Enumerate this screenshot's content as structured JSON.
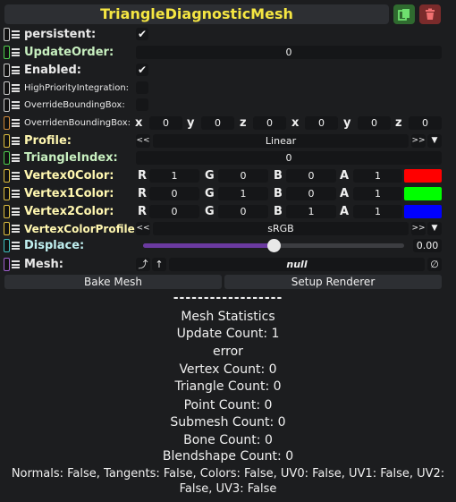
{
  "header": {
    "title": "TriangleDiagnosticMesh",
    "copy_icon": "copy-icon",
    "delete_icon": "trash-icon"
  },
  "fields": {
    "persistent": {
      "label": "persistent:",
      "checked": true
    },
    "update_order": {
      "label": "UpdateOrder:",
      "value": "0"
    },
    "enabled": {
      "label": "Enabled:",
      "checked": true
    },
    "high_priority": {
      "label": "HighPriorityIntegration:",
      "checked": false
    },
    "override_bbox": {
      "label": "OverrideBoundingBox:",
      "checked": false
    },
    "overriden_bbox": {
      "label": "OverridenBoundingBox:",
      "axes": [
        "x",
        "y",
        "z",
        "x",
        "y",
        "z"
      ],
      "values": [
        "0",
        "0",
        "0",
        "0",
        "0",
        "0"
      ]
    },
    "profile": {
      "label": "Profile:",
      "value": "Linear",
      "prev": "<<",
      "next": ">>"
    },
    "triangle_index": {
      "label": "TriangleIndex:",
      "value": "0"
    },
    "vertex0": {
      "label": "Vertex0Color:",
      "r": "1",
      "g": "0",
      "b": "0",
      "a": "1",
      "swatch": "#ff0000"
    },
    "vertex1": {
      "label": "Vertex1Color:",
      "r": "0",
      "g": "1",
      "b": "0",
      "a": "1",
      "swatch": "#00ff00"
    },
    "vertex2": {
      "label": "Vertex2Color:",
      "r": "0",
      "g": "0",
      "b": "1",
      "a": "1",
      "swatch": "#0000ff"
    },
    "channels": {
      "r": "R",
      "g": "G",
      "b": "B",
      "a": "A"
    },
    "vertex_color_profile": {
      "label": "VertexColorProfile:",
      "value": "sRGB",
      "prev": "<<",
      "next": ">>"
    },
    "displace": {
      "label": "Displace:",
      "value": "0.00",
      "level": 0.5
    },
    "mesh": {
      "label": "Mesh:",
      "value": "null"
    }
  },
  "buttons": {
    "bake": "Bake Mesh",
    "setup": "Setup Renderer"
  },
  "stats": {
    "separator": "------------------",
    "title": "Mesh Statistics",
    "update_count": "Update Count: 1",
    "error": "error",
    "vertex_count": "Vertex Count: 0",
    "triangle_count": "Triangle Count: 0",
    "point_count": "Point Count: 0",
    "submesh_count": "Submesh Count: 0",
    "bone_count": "Bone Count: 0",
    "blendshape_count": "Blendshape Count: 0",
    "attributes_line1": "Normals: False, Tangents: False, Colors: False, UV0: False, UV1: False, UV2:",
    "attributes_line2": "False, UV3: False"
  },
  "colors": {
    "title": "#f5e642",
    "slider": "#6b3aa0"
  }
}
